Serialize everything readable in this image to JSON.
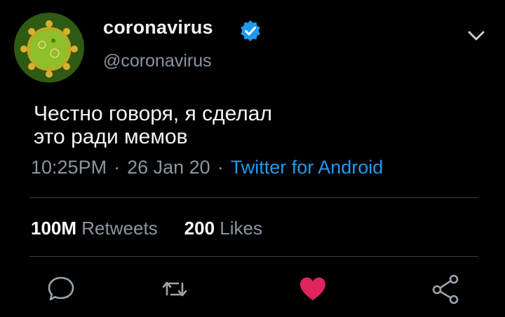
{
  "tweet": {
    "author": {
      "display_name": "coronavirus",
      "handle": "@coronavirus",
      "verified": true,
      "avatar_icon": "virus-avatar-icon"
    },
    "text_lines": [
      "Честно говоря, я сделал",
      "это ради мемов"
    ],
    "time": "10:25PM",
    "date": "26 Jan 20",
    "separator": "·",
    "source": "Twitter for Android",
    "stats": {
      "retweets_count": "100M",
      "retweets_label": "Retweets",
      "likes_count": "200",
      "likes_label": "Likes"
    },
    "actions": [
      {
        "name": "reply",
        "icon": "reply-bubble-icon"
      },
      {
        "name": "retweet",
        "icon": "retweet-icon"
      },
      {
        "name": "like",
        "icon": "heart-icon",
        "active": true
      },
      {
        "name": "share",
        "icon": "share-icon"
      }
    ]
  },
  "colors": {
    "background": "#000000",
    "text": "#ffffff",
    "secondary_text": "#8b96a0",
    "link": "#1d9bf0",
    "verified": "#1d9bf0",
    "like_active": "#e0245e",
    "divider": "#3a3f44"
  }
}
